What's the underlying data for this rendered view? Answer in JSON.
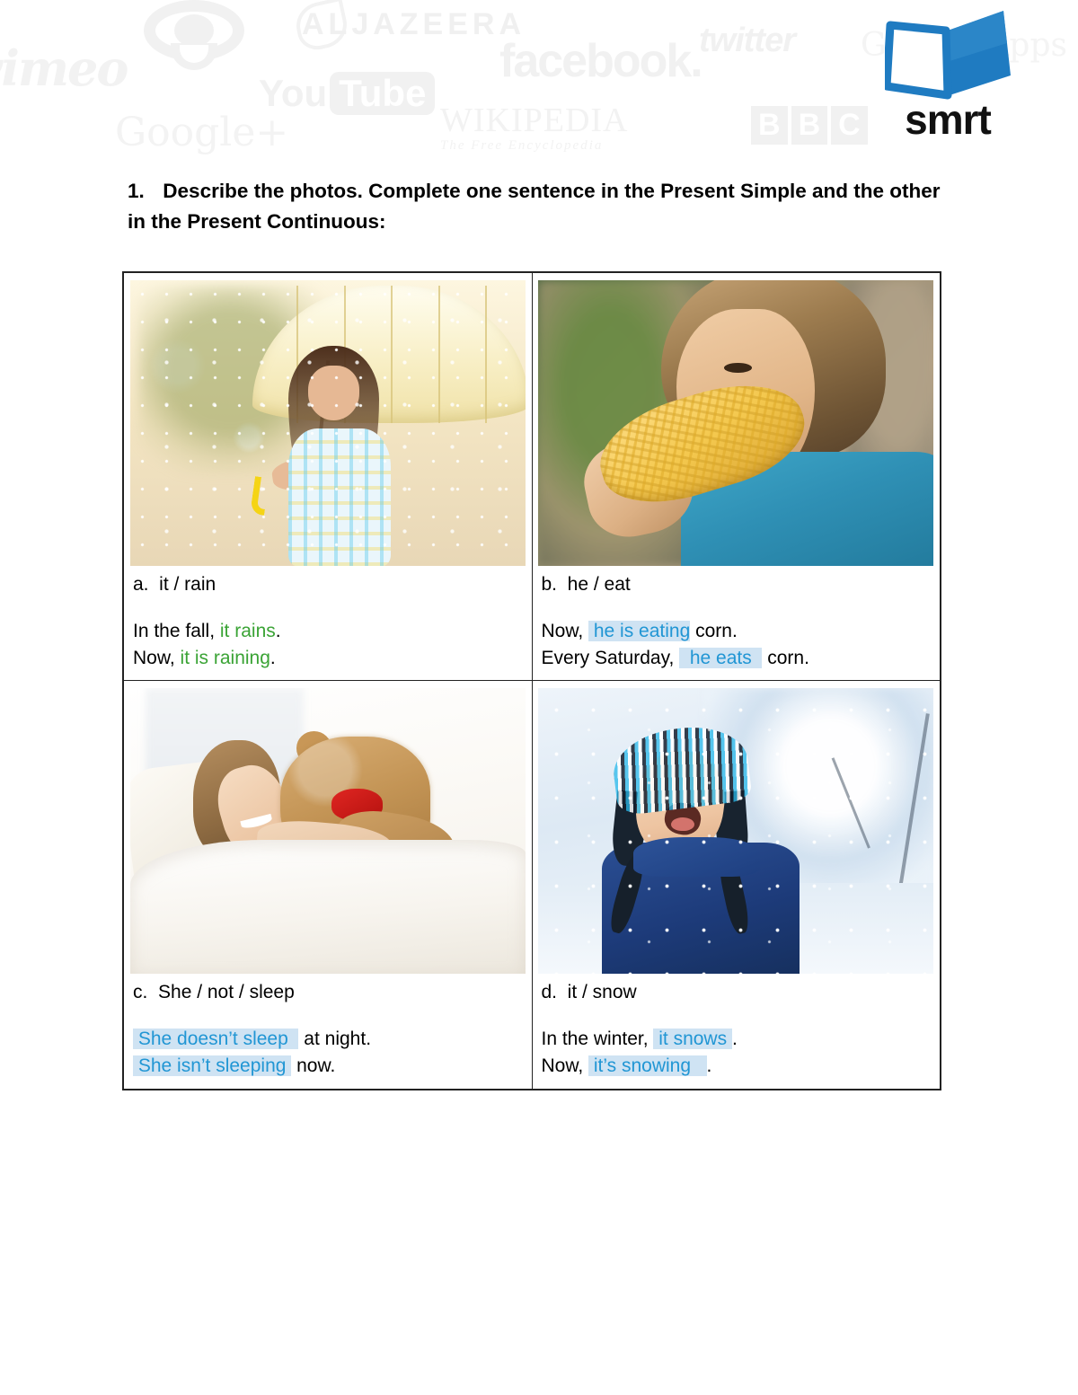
{
  "header": {
    "watermarks": [
      {
        "name": "vimeo-logo",
        "label": "vimeo"
      },
      {
        "name": "cbc-logo",
        "label": ""
      },
      {
        "name": "aljazeera-logo",
        "label": "ALJAZEERA"
      },
      {
        "name": "youtube-logo",
        "label": "You",
        "label2": "Tube"
      },
      {
        "name": "facebook-logo",
        "label": "facebook."
      },
      {
        "name": "googleplus-logo",
        "label": "Google+"
      },
      {
        "name": "wikipedia-logo",
        "label": "WIKIPEDIA",
        "tagline": "The Free Encyclopedia"
      },
      {
        "name": "twitter-logo",
        "label": "twitter"
      },
      {
        "name": "google-apps-logo",
        "label": "Google Apps for B"
      },
      {
        "name": "bbc-logo",
        "letters": [
          "B",
          "B",
          "C"
        ]
      }
    ],
    "brand": {
      "name": "smrt",
      "book_color": "#1F7BC1",
      "text_color": "#111111"
    }
  },
  "instruction": {
    "number": "1.",
    "text": "Describe the photos. Complete one sentence in the Present Simple and the other in the Present Continuous:"
  },
  "colors": {
    "answer_green": "#3AA335",
    "answer_blue": "#2196D4",
    "answer_highlight": "#CFE3F3",
    "border": "#222222"
  },
  "exercises": [
    {
      "id": "a",
      "photo_name": "photo-girl-umbrella-rain",
      "photo_alt": "Girl holding a cream umbrella in the rain",
      "prompt": "a.  it / rain",
      "lines": [
        {
          "segments": [
            {
              "text": "In the fall, ",
              "style": "plain"
            },
            {
              "text": "it rains",
              "style": "green"
            },
            {
              "text": ".",
              "style": "plain"
            }
          ]
        },
        {
          "segments": [
            {
              "text": "Now, ",
              "style": "plain"
            },
            {
              "text": "it is raining",
              "style": "green"
            },
            {
              "text": ".",
              "style": "plain"
            }
          ]
        }
      ]
    },
    {
      "id": "b",
      "photo_name": "photo-boy-eating-corn",
      "photo_alt": "Boy in a teal shirt eating corn on the cob",
      "prompt": "b.  he / eat",
      "lines": [
        {
          "segments": [
            {
              "text": "Now, ",
              "style": "plain"
            },
            {
              "text": " he is eating",
              "style": "blue"
            },
            {
              "text": " corn.",
              "style": "plain"
            }
          ]
        },
        {
          "segments": [
            {
              "text": "Every Saturday, ",
              "style": "plain"
            },
            {
              "text": "  he eats  ",
              "style": "blue"
            },
            {
              "text": " corn.",
              "style": "plain"
            }
          ]
        }
      ]
    },
    {
      "id": "c",
      "photo_name": "photo-girl-in-bed-teddy",
      "photo_alt": "Girl lying in a white bed hugging a teddy bear",
      "prompt": "c.  She / not / sleep",
      "lines": [
        {
          "segments": [
            {
              "text": " She doesn’t sleep  ",
              "style": "blue"
            },
            {
              "text": " at night.",
              "style": "plain"
            }
          ]
        },
        {
          "segments": [
            {
              "text": " She isn’t sleeping ",
              "style": "blue"
            },
            {
              "text": " now.",
              "style": "plain"
            }
          ]
        }
      ]
    },
    {
      "id": "d",
      "photo_name": "photo-boy-in-snow",
      "photo_alt": "Boy in a navy coat and knit hat catching snowflakes",
      "prompt": "d.  it / snow",
      "lines": [
        {
          "segments": [
            {
              "text": "In the winter, ",
              "style": "plain"
            },
            {
              "text": " it snows ",
              "style": "blue"
            },
            {
              "text": ".",
              "style": "plain"
            }
          ]
        },
        {
          "segments": [
            {
              "text": "Now, ",
              "style": "plain"
            },
            {
              "text": " it’s snowing   ",
              "style": "blue"
            },
            {
              "text": ".",
              "style": "plain"
            }
          ]
        }
      ]
    }
  ]
}
